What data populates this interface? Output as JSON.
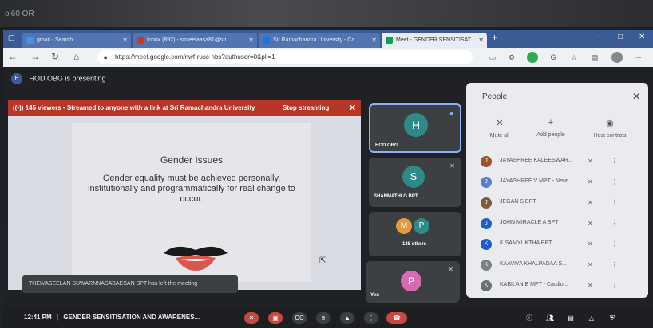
{
  "bezel": {
    "text": "oi60 OR"
  },
  "browser": {
    "tabs": [
      {
        "label": "gmail - Search",
        "color": "#4a90e2"
      },
      {
        "label": "Inbox (892) - smleelaasa81@sri...",
        "color": "#d93025"
      },
      {
        "label": "Sri Ramachandra University - Ca...",
        "color": "#1a73e8"
      },
      {
        "label": "Meet - GENDER SENSITISAT...",
        "color": "#0f9d58"
      }
    ],
    "url": "https://meet.google.com/nwf-rusc-nbs?authuser=0&pli=1",
    "new_tab": "+",
    "win_min": "–",
    "win_max": "□",
    "win_close": "✕"
  },
  "meet": {
    "presenting_initial": "H",
    "presenting_text": "HOD OBG is presenting",
    "stream_banner": "145 viewers • Streamed to anyone with a link at Sri Ramachandra University",
    "stop_streaming": "Stop streaming",
    "slide": {
      "title": "Gender Issues",
      "body": "Gender equality must be achieved personally, institutionally and programmatically for real change to occur."
    },
    "toast": "THEIVASEELAN SUWARNNASABAESAN BPT has left the meeting",
    "tiles": [
      {
        "initial": "H",
        "name": "HOD OBG",
        "color": "#2d8a86"
      },
      {
        "initial": "S",
        "name": "SHANMATHI G BPT",
        "color": "#2d8a86"
      },
      {
        "initial_1": "M",
        "initial_2": "P",
        "name": "138 others",
        "color_1": "#e39b3b",
        "color_2": "#2d8a86"
      },
      {
        "initial": "P",
        "name": "You",
        "color": "#d86ab2"
      }
    ]
  },
  "people": {
    "title": "People",
    "mute_all": "Mute all",
    "add_people": "Add people",
    "host_controls": "Host controls",
    "list": [
      {
        "name": "JAYASHREE KALEESWAR...",
        "initial": "J",
        "color": "#a0522d"
      },
      {
        "name": "JAYASHREE V MPT - Neur...",
        "initial": "J",
        "color": "#5c7fc4"
      },
      {
        "name": "JEGAN S BPT",
        "initial": "J",
        "color": "#7d5b3c"
      },
      {
        "name": "JOHN MIRACLE A BPT",
        "initial": "J",
        "color": "#1e5cc8"
      },
      {
        "name": "K SAMYUKTHA BPT",
        "initial": "K",
        "color": "#1e5cc8"
      },
      {
        "name": "KAAVIYA KHALPADAA S...",
        "initial": "K",
        "color": "#7a7f88"
      },
      {
        "name": "KABILAN B MPT - Cardio...",
        "initial": "K",
        "color": "#6b6f76"
      }
    ]
  },
  "bottom": {
    "time": "12:41 PM",
    "separator": "|",
    "meeting_title": "GENDER SENSITISATION AND AWARENES..."
  }
}
